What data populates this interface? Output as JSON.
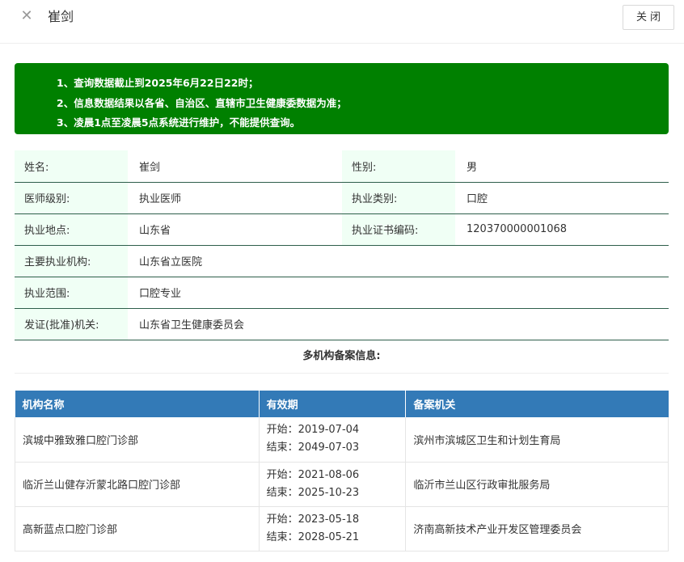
{
  "header": {
    "close_icon": "close-icon",
    "close_glyph": "✕",
    "title": "崔剑",
    "close_button": "关闭"
  },
  "notice": {
    "lines": [
      "1、查询数据截止到2025年6月22日22时；",
      "2、信息数据结果以各省、自治区、直辖市卫生健康委数据为准；",
      "3、凌晨1点至凌晨5点系统进行维护，不能提供查询。"
    ],
    "background": "#008000"
  },
  "info": {
    "name_label": "姓名:",
    "name_value": "崔剑",
    "gender_label": "性别:",
    "gender_value": "男",
    "level_label": "医师级别:",
    "level_value": "执业医师",
    "category_label": "执业类别:",
    "category_value": "口腔",
    "location_label": "执业地点:",
    "location_value": "山东省",
    "cert_label": "执业证书编码:",
    "cert_value": "120370000001068",
    "institution_label": "主要执业机构:",
    "institution_value": "山东省立医院",
    "scope_label": "执业范围:",
    "scope_value": "口腔专业",
    "issuer_label": "发证(批准)机关:",
    "issuer_value": "山东省卫生健康委员会"
  },
  "multi_org": {
    "title": "多机构备案信息:",
    "headers": [
      "机构名称",
      "有效期",
      "备案机关"
    ],
    "rows": [
      {
        "name": "滨城中雅致雅口腔门诊部",
        "start": "开始：2019-07-04",
        "end": "结束：2049-07-03",
        "authority": "滨州市滨城区卫生和计划生育局"
      },
      {
        "name": "临沂兰山健存沂蒙北路口腔门诊部",
        "start": "开始：2021-08-06",
        "end": "结束：2025-10-23",
        "authority": "临沂市兰山区行政审批服务局"
      },
      {
        "name": "高新蓝点口腔门诊部",
        "start": "开始：2023-05-18",
        "end": "结束：2028-05-21",
        "authority": "济南高新技术产业开发区管理委员会"
      }
    ],
    "header_color": "#337ab7"
  }
}
